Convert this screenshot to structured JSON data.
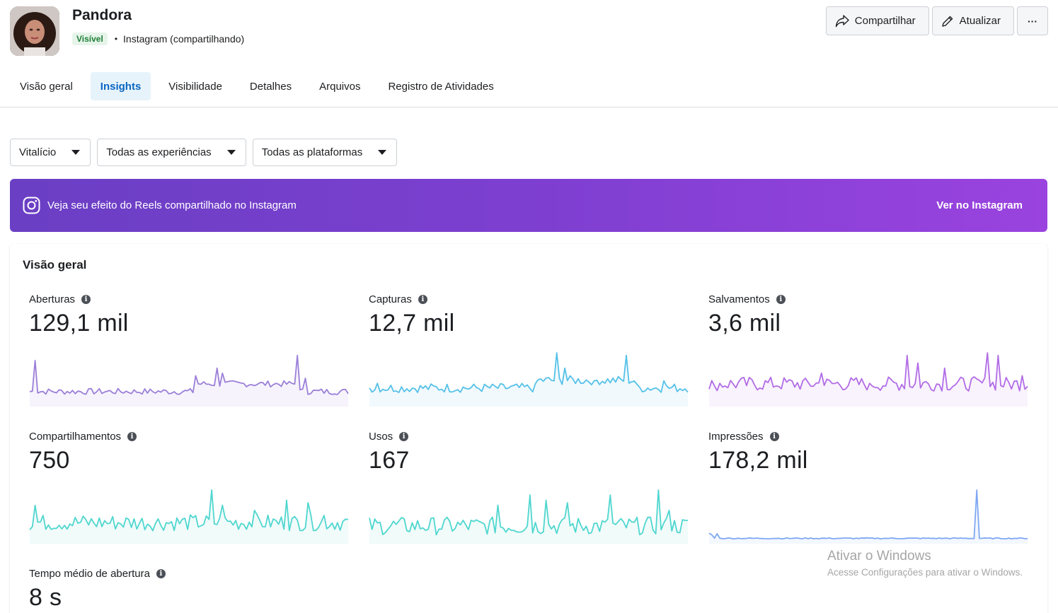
{
  "effect": {
    "name": "Pandora",
    "status_badge": "Visível",
    "platform_text": "Instagram (compartilhando)"
  },
  "actions": {
    "share_label": "Compartilhar",
    "update_label": "Atualizar",
    "more_label": "···"
  },
  "tabs": [
    {
      "label": "Visão geral",
      "active": false
    },
    {
      "label": "Insights",
      "active": true
    },
    {
      "label": "Visibilidade",
      "active": false
    },
    {
      "label": "Detalhes",
      "active": false
    },
    {
      "label": "Arquivos",
      "active": false
    },
    {
      "label": "Registro de Atividades",
      "active": false
    }
  ],
  "filters": {
    "period": "Vitalício",
    "experiences": "Todas as experiências",
    "platforms": "Todas as plataformas"
  },
  "banner": {
    "text": "Veja seu efeito do Reels compartilhado no Instagram",
    "link": "Ver no Instagram",
    "icon": "instagram-icon"
  },
  "overview": {
    "title": "Visão geral",
    "metrics": [
      {
        "label": "Aberturas",
        "value": "129,1 mil",
        "color": "#9b7fd8",
        "fill": "#f6f3fc"
      },
      {
        "label": "Capturas",
        "value": "12,7 mil",
        "color": "#55c1e8",
        "fill": "#f1f9fd"
      },
      {
        "label": "Salvamentos",
        "value": "3,6 mil",
        "color": "#b26ce6",
        "fill": "#f9f3fd"
      },
      {
        "label": "Compartilhamentos",
        "value": "750",
        "color": "#4fd6cf",
        "fill": "#f0fbfa"
      },
      {
        "label": "Usos",
        "value": "167",
        "color": "#4fd6cf",
        "fill": "#f0fbfa"
      },
      {
        "label": "Impressões",
        "value": "178,2 mil",
        "color": "#7fa8f2",
        "fill": "#f3f7fe"
      },
      {
        "label": "Tempo médio de abertura",
        "value": "8 s"
      }
    ]
  },
  "watermark": {
    "title": "Ativar o Windows",
    "subtitle": "Acesse Configurações para ativar o Windows."
  }
}
